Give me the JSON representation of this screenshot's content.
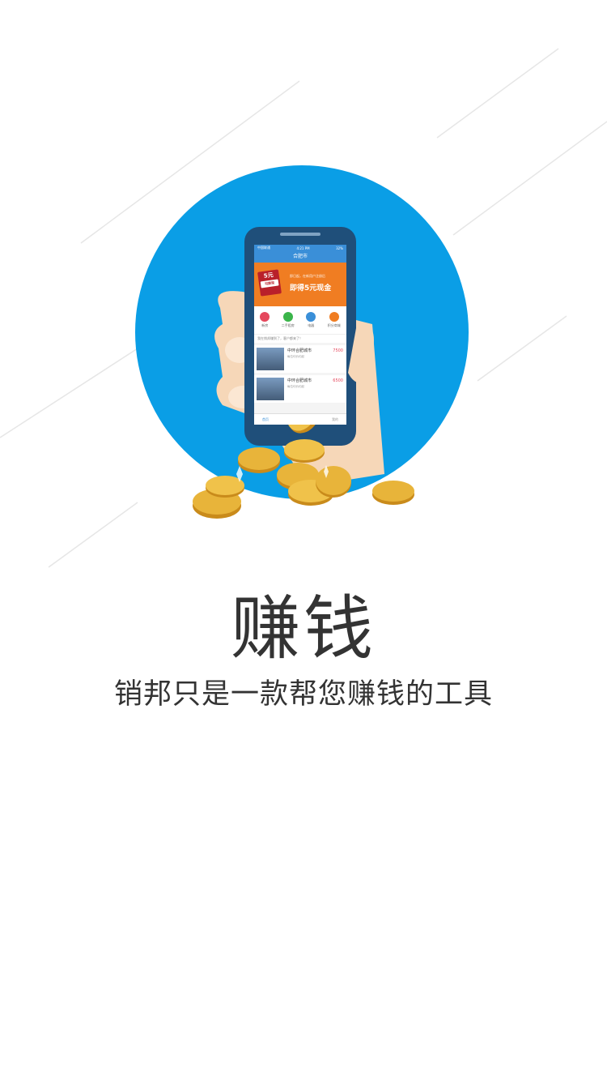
{
  "hero": {
    "phone": {
      "status_left": "中国联通",
      "status_time": "4:21 PM",
      "status_right": "32%",
      "city": "合肥市",
      "banner_tag_value": "5元",
      "banner_tag_label": "可提现",
      "banner_small": "即日起，在新用户注册后",
      "banner_big": "即得5元现金",
      "icons": [
        {
          "label": "新房",
          "color": "#e5485d"
        },
        {
          "label": "二手租房",
          "color": "#3bb54a"
        },
        {
          "label": "电器",
          "color": "#3a8fd8"
        },
        {
          "label": "积分商城",
          "color": "#f07d22"
        }
      ],
      "notice": "我在销邦赚到了，客户都来了！",
      "listings": [
        {
          "title": "中环合肥城市",
          "price": "7500",
          "meta": "每位均价约起"
        },
        {
          "title": "中环合肥城市",
          "price": "6500",
          "meta": "每位均价约起"
        }
      ],
      "tabs": {
        "home": "首页",
        "mine": "我的"
      }
    },
    "colors": {
      "circle": "#0a9ee6",
      "hand": "#f6d7b8",
      "phone_body": "#1f4f7a",
      "coin": "#e8b43a"
    }
  },
  "headline": "赚钱",
  "tagline": "销邦只是一款帮您赚钱的工具"
}
